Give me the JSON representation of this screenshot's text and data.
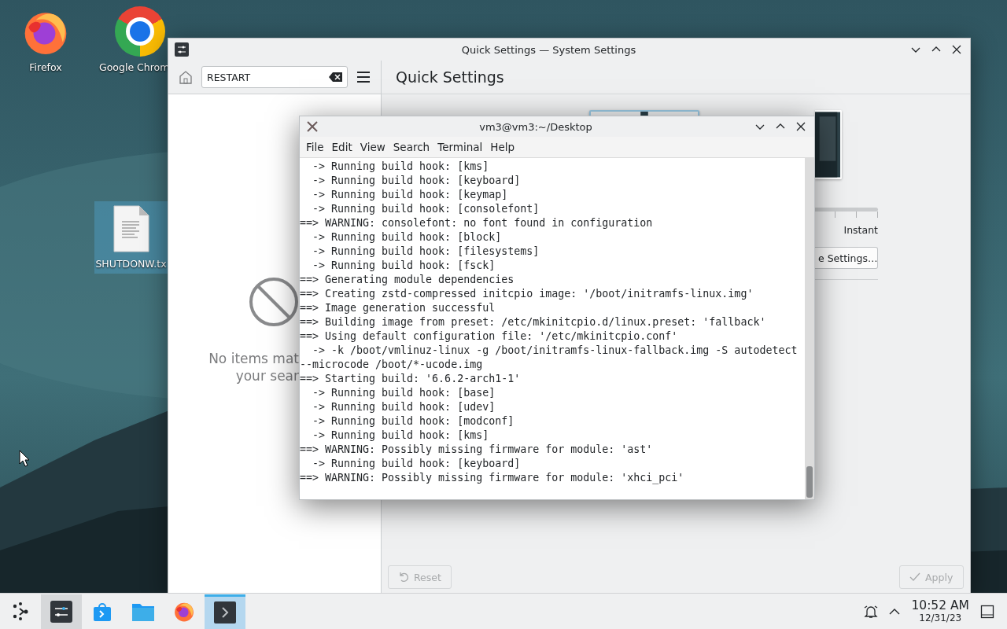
{
  "desktop_icons": [
    {
      "label": "Firefox",
      "kind": "firefox",
      "selected": false
    },
    {
      "label": "Google Chrom",
      "kind": "chrome",
      "selected": false
    },
    {
      "label": "SHUTDONW.tx",
      "kind": "file",
      "selected": true
    }
  ],
  "settings_window": {
    "title": "Quick Settings — System Settings",
    "search": {
      "value": "RESTART"
    },
    "empty_message": [
      "No items mat",
      "your sear"
    ],
    "page_title": "Quick Settings",
    "slider_label": "Instant",
    "more_button": "e Settings…",
    "buttons": [
      {
        "label": "Reset",
        "kind": "reset",
        "disabled": true
      },
      {
        "label": "Apply",
        "kind": "apply",
        "disabled": true
      }
    ]
  },
  "terminal_window": {
    "title": "vm3@vm3:~/Desktop",
    "menu": [
      "File",
      "Edit",
      "View",
      "Search",
      "Terminal",
      "Help"
    ],
    "lines": [
      "  -> Running build hook: [kms]",
      "  -> Running build hook: [keyboard]",
      "  -> Running build hook: [keymap]",
      "  -> Running build hook: [consolefont]",
      "==> WARNING: consolefont: no font found in configuration",
      "  -> Running build hook: [block]",
      "  -> Running build hook: [filesystems]",
      "  -> Running build hook: [fsck]",
      "==> Generating module dependencies",
      "==> Creating zstd-compressed initcpio image: '/boot/initramfs-linux.img'",
      "==> Image generation successful",
      "==> Building image from preset: /etc/mkinitcpio.d/linux.preset: 'fallback'",
      "==> Using default configuration file: '/etc/mkinitcpio.conf'",
      "  -> -k /boot/vmlinuz-linux -g /boot/initramfs-linux-fallback.img -S autodetect",
      "--microcode /boot/*-ucode.img",
      "==> Starting build: '6.6.2-arch1-1'",
      "  -> Running build hook: [base]",
      "  -> Running build hook: [udev]",
      "  -> Running build hook: [modconf]",
      "  -> Running build hook: [kms]",
      "==> WARNING: Possibly missing firmware for module: 'ast'",
      "  -> Running build hook: [keyboard]",
      "==> WARNING: Possibly missing firmware for module: 'xhci_pci'"
    ]
  },
  "taskbar": {
    "items": [
      {
        "kind": "launcher",
        "selected": false,
        "open": false
      },
      {
        "kind": "settings",
        "selected": false,
        "open": true
      },
      {
        "kind": "store",
        "selected": false,
        "open": false
      },
      {
        "kind": "folder",
        "selected": false,
        "open": false
      },
      {
        "kind": "firefox",
        "selected": false,
        "open": false
      },
      {
        "kind": "terminal",
        "selected": true,
        "open": true
      }
    ],
    "time": "10:52 AM",
    "date": "12/31/23"
  }
}
